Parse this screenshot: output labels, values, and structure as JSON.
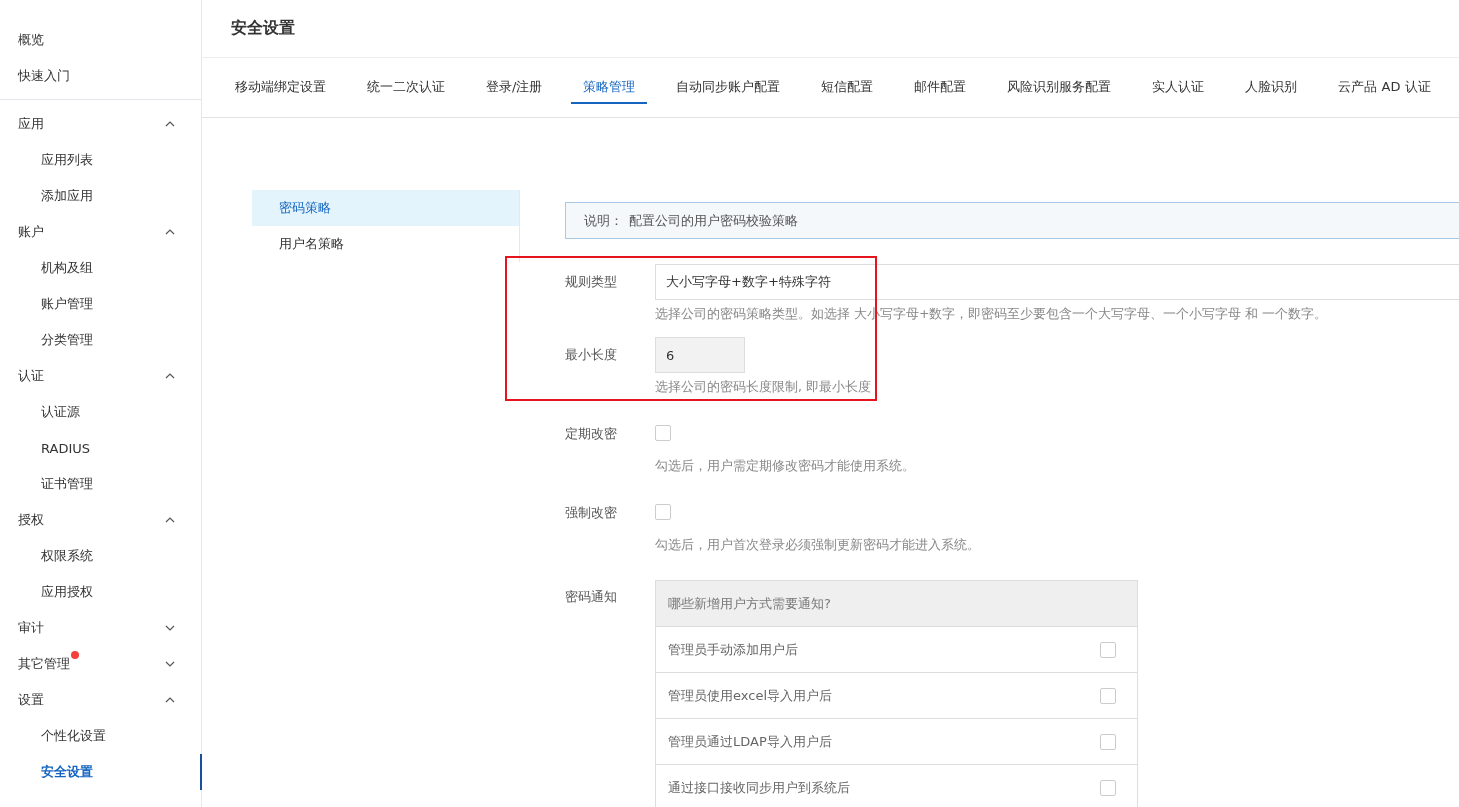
{
  "sidebar": {
    "top_items": [
      {
        "label": "概览",
        "selected": false
      },
      {
        "label": "快速入门",
        "selected": false
      }
    ],
    "groups": [
      {
        "label": "应用",
        "expanded": true,
        "badge": false,
        "children": [
          {
            "label": "应用列表",
            "selected": false
          },
          {
            "label": "添加应用",
            "selected": false
          }
        ]
      },
      {
        "label": "账户",
        "expanded": true,
        "badge": false,
        "children": [
          {
            "label": "机构及组",
            "selected": false
          },
          {
            "label": "账户管理",
            "selected": false
          },
          {
            "label": "分类管理",
            "selected": false
          }
        ]
      },
      {
        "label": "认证",
        "expanded": true,
        "badge": false,
        "children": [
          {
            "label": "认证源",
            "selected": false
          },
          {
            "label": "RADIUS",
            "selected": false
          },
          {
            "label": "证书管理",
            "selected": false
          }
        ]
      },
      {
        "label": "授权",
        "expanded": true,
        "badge": false,
        "children": [
          {
            "label": "权限系统",
            "selected": false
          },
          {
            "label": "应用授权",
            "selected": false
          }
        ]
      },
      {
        "label": "审计",
        "expanded": false,
        "badge": false
      },
      {
        "label": "其它管理",
        "expanded": false,
        "badge": true
      },
      {
        "label": "设置",
        "expanded": true,
        "badge": false,
        "children": [
          {
            "label": "个性化设置",
            "selected": false
          },
          {
            "label": "安全设置",
            "selected": true
          }
        ]
      }
    ]
  },
  "page_title": "安全设置",
  "tabs": [
    {
      "label": "移动端绑定设置",
      "selected": false
    },
    {
      "label": "统一二次认证",
      "selected": false
    },
    {
      "label": "登录/注册",
      "selected": false
    },
    {
      "label": "策略管理",
      "selected": true
    },
    {
      "label": "自动同步账户配置",
      "selected": false
    },
    {
      "label": "短信配置",
      "selected": false
    },
    {
      "label": "邮件配置",
      "selected": false
    },
    {
      "label": "风险识别服务配置",
      "selected": false
    },
    {
      "label": "实人认证",
      "selected": false
    },
    {
      "label": "人脸识别",
      "selected": false
    },
    {
      "label": "云产品 AD 认证",
      "selected": false
    }
  ],
  "sub_nav": [
    {
      "label": "密码策略",
      "selected": true
    },
    {
      "label": "用户名策略",
      "selected": false
    }
  ],
  "notice": {
    "label": "说明：",
    "text": "配置公司的用户密码校验策略"
  },
  "fields": [
    {
      "kind": "input",
      "label": "规则类型",
      "value": "大小写字母+数字+特殊字符",
      "disabled": false,
      "help": "选择公司的密码策略类型。如选择 大小写字母+数字，即密码至少要包含一个大写字母、一个小写字母 和 一个数字。"
    },
    {
      "kind": "input",
      "label": "最小长度",
      "value": "6",
      "disabled": true,
      "help": "选择公司的密码长度限制, 即最小长度"
    },
    {
      "kind": "checkbox",
      "label": "定期改密",
      "checked": false,
      "help": "勾选后，用户需定期修改密码才能使用系统。"
    },
    {
      "kind": "checkbox",
      "label": "强制改密",
      "checked": false,
      "help": "勾选后，用户首次登录必须强制更新密码才能进入系统。"
    }
  ],
  "notification": {
    "label": "密码通知",
    "header": "哪些新增用户方式需要通知?",
    "options": [
      {
        "label": "管理员手动添加用户后",
        "checked": false
      },
      {
        "label": "管理员使用excel导入用户后",
        "checked": false
      },
      {
        "label": "管理员通过LDAP导入用户后",
        "checked": false
      },
      {
        "label": "通过接口接收同步用户到系统后",
        "checked": false
      }
    ]
  }
}
